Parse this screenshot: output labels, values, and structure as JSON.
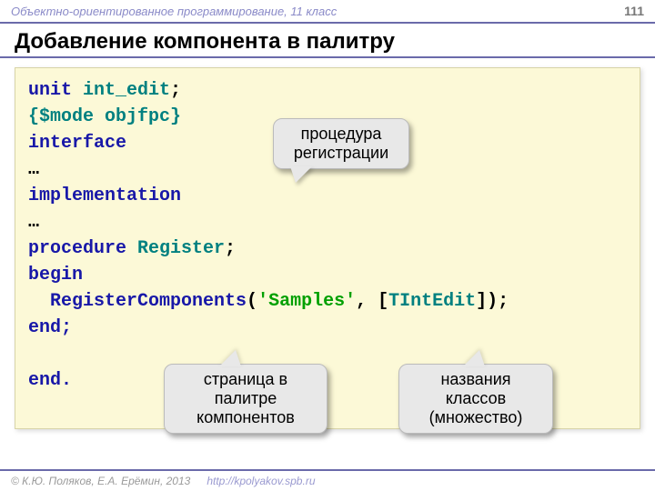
{
  "header": {
    "subject": "Объектно-ориентированное программирование, 11 класс",
    "page": "111"
  },
  "title": "Добавление компонента в палитру",
  "code": {
    "l1a": "unit ",
    "l1b": "int_edit",
    "l1c": ";",
    "l2": "{$mode objfpc}",
    "l3": "interface",
    "l4": "…",
    "l5": "implementation",
    "l6": "…",
    "l7a": "procedure ",
    "l7b": "Register",
    "l7c": ";",
    "l8": "begin",
    "l9a": "  RegisterComponents",
    "l9b": "(",
    "l9c": "'Samples'",
    "l9d": ", [",
    "l9e": "TIntEdit",
    "l9f": "]);",
    "l10": "end;",
    "l11": "",
    "l12": "end."
  },
  "callouts": {
    "c1": "процедура регистрации",
    "c2": "страница в палитре компонентов",
    "c3": "названия классов (множество)"
  },
  "footer": {
    "copyright": "© К.Ю. Поляков, Е.А. Ерёмин, 2013",
    "url": "http://kpolyakov.spb.ru"
  }
}
